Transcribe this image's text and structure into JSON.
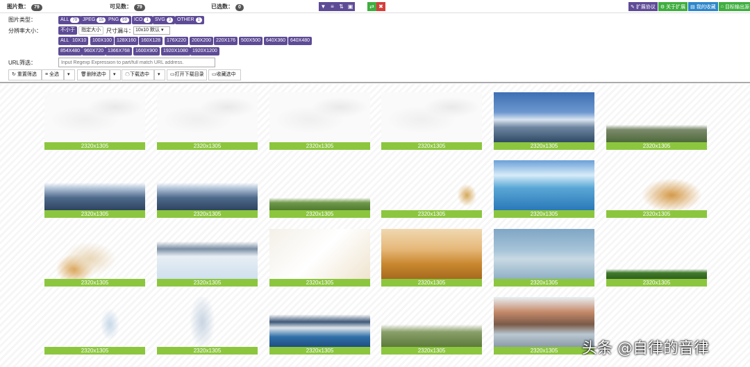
{
  "stats": {
    "images_label": "图片数：",
    "images_count": "79",
    "visible_label": "可见数：",
    "visible_count": "79",
    "selected_label": "已选数：",
    "selected_count": "0"
  },
  "center_icons": [
    "filter-icon",
    "list-icon",
    "sort-icon",
    "select-icon"
  ],
  "action_icons": [
    "swap-icon",
    "close-icon"
  ],
  "right_buttons": [
    {
      "label": "扩展协议",
      "icon": "wrench-icon",
      "color": "#5e4b96"
    },
    {
      "label": "关于扩展",
      "icon": "gear-icon",
      "color": "#3fae3f"
    },
    {
      "label": "我的收藏",
      "icon": "folder-icon",
      "color": "#2e86c9"
    },
    {
      "label": "目标输出源",
      "icon": "home-icon",
      "color": "#3fae3f"
    }
  ],
  "filters": {
    "type_label": "图片类型：",
    "types": [
      {
        "label": "ALL",
        "count": "79"
      },
      {
        "label": "JPEG",
        "count": "15"
      },
      {
        "label": "PNG",
        "count": "59"
      },
      {
        "label": "ICO",
        "count": "1"
      },
      {
        "label": "SVG",
        "count": "3"
      },
      {
        "label": "OTHER",
        "count": "1"
      }
    ],
    "res_label": "分辨率大小：",
    "res_mode_min": "不小于",
    "res_mode_custom": "指定大小",
    "size_label": "尺寸漏斗：",
    "size_select": "10x10 默认",
    "res_row1": [
      "ALL",
      "10X10",
      "100X100",
      "128X160",
      "160X128",
      "176X220",
      "200X200",
      "220X176",
      "500X500",
      "640X360",
      "640X480"
    ],
    "res_row2": [
      "854X480",
      "960X720",
      "1366X768",
      "1600X900",
      "1920X1080",
      "1920X1200"
    ],
    "url_label": "URL筛选：",
    "url_placeholder": "Input Regexp Expression to part/full match URL address."
  },
  "toolbar": {
    "reset": "重置筛选",
    "select_all": "全选",
    "delete": "删除选中",
    "download": "下载选中",
    "open_dir": "打开下载目录",
    "collect": "收藏选中"
  },
  "images": [
    {
      "caption": "2320x1305",
      "scene": "cloud"
    },
    {
      "caption": "2320x1305",
      "scene": "cloud"
    },
    {
      "caption": "2320x1305",
      "scene": "cloud"
    },
    {
      "caption": "2320x1305",
      "scene": "cloud"
    },
    {
      "caption": "2320x1305",
      "scene": "mountain-blue"
    },
    {
      "caption": "2320x1305",
      "scene": "trees"
    },
    {
      "caption": "2320x1305",
      "scene": "mountain-low"
    },
    {
      "caption": "2320x1305",
      "scene": "mountain-low"
    },
    {
      "caption": "2320x1305",
      "scene": "bottle-hill"
    },
    {
      "caption": "2320x1305",
      "scene": "wheat-sprig"
    },
    {
      "caption": "2320x1305",
      "scene": "ocean-blue"
    },
    {
      "caption": "2320x1305",
      "scene": "wheat"
    },
    {
      "caption": "2320x1305",
      "scene": "bottle-wheat"
    },
    {
      "caption": "2320x1305",
      "scene": "mountain-snow"
    },
    {
      "caption": "2320x1305",
      "scene": "wheat-light"
    },
    {
      "caption": "2320x1305",
      "scene": "wheat-field"
    },
    {
      "caption": "2320x1305",
      "scene": "sea-mist"
    },
    {
      "caption": "2320x1305",
      "scene": "grass"
    },
    {
      "caption": "2320x1305",
      "scene": "bottle-small"
    },
    {
      "caption": "2320x1305",
      "scene": "bottle-big"
    },
    {
      "caption": "2320x1305",
      "scene": "mountain-range"
    },
    {
      "caption": "2320x1305",
      "scene": "hill-green"
    },
    {
      "caption": "2320x1305",
      "scene": "rocky"
    }
  ],
  "watermark": "头条 @自律的音律"
}
